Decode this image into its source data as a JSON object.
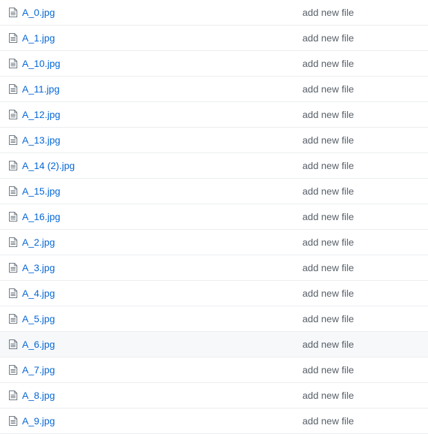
{
  "files": [
    {
      "name": "A_0.jpg",
      "commit": "add new file",
      "icon": "file-icon",
      "highlighted": false
    },
    {
      "name": "A_1.jpg",
      "commit": "add new file",
      "icon": "file-icon",
      "highlighted": false
    },
    {
      "name": "A_10.jpg",
      "commit": "add new file",
      "icon": "file-icon",
      "highlighted": false
    },
    {
      "name": "A_11.jpg",
      "commit": "add new file",
      "icon": "file-icon",
      "highlighted": false
    },
    {
      "name": "A_12.jpg",
      "commit": "add new file",
      "icon": "file-icon",
      "highlighted": false
    },
    {
      "name": "A_13.jpg",
      "commit": "add new file",
      "icon": "file-icon",
      "highlighted": false
    },
    {
      "name": "A_14 (2).jpg",
      "commit": "add new file",
      "icon": "file-icon",
      "highlighted": false
    },
    {
      "name": "A_15.jpg",
      "commit": "add new file",
      "icon": "file-icon",
      "highlighted": false
    },
    {
      "name": "A_16.jpg",
      "commit": "add new file",
      "icon": "file-icon",
      "highlighted": false
    },
    {
      "name": "A_2.jpg",
      "commit": "add new file",
      "icon": "file-icon",
      "highlighted": false
    },
    {
      "name": "A_3.jpg",
      "commit": "add new file",
      "icon": "file-icon",
      "highlighted": false
    },
    {
      "name": "A_4.jpg",
      "commit": "add new file",
      "icon": "file-icon",
      "highlighted": false
    },
    {
      "name": "A_5.jpg",
      "commit": "add new file",
      "icon": "file-icon",
      "highlighted": false
    },
    {
      "name": "A_6.jpg",
      "commit": "add new file",
      "icon": "file-icon",
      "highlighted": true
    },
    {
      "name": "A_7.jpg",
      "commit": "add new file",
      "icon": "file-icon",
      "highlighted": false
    },
    {
      "name": "A_8.jpg",
      "commit": "add new file",
      "icon": "file-icon",
      "highlighted": false
    },
    {
      "name": "A_9.jpg",
      "commit": "add new file",
      "icon": "file-icon",
      "highlighted": false
    }
  ],
  "colors": {
    "link": "#0366d6",
    "commit_text": "#586069",
    "row_border": "#eaecef",
    "row_highlight": "#f6f8fa",
    "icon": "#6a737d"
  }
}
